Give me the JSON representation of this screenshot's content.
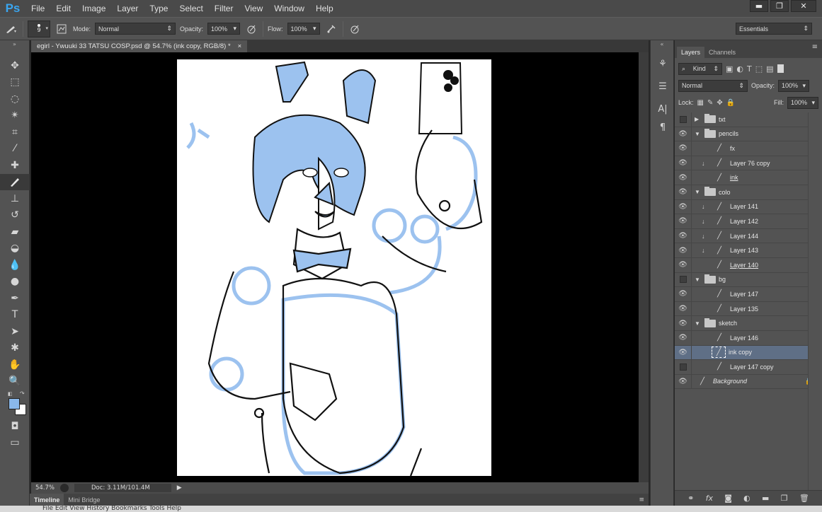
{
  "app": {
    "logo": "Ps"
  },
  "menu": [
    "File",
    "Edit",
    "Image",
    "Layer",
    "Type",
    "Select",
    "Filter",
    "View",
    "Window",
    "Help"
  ],
  "window_buttons": {
    "minimize": "▬",
    "restore": "❐",
    "close": "✕"
  },
  "options": {
    "brush_size": "9",
    "mode_label": "Mode:",
    "mode_value": "Normal",
    "opacity_label": "Opacity:",
    "opacity_value": "100%",
    "flow_label": "Flow:",
    "flow_value": "100%",
    "workspace": "Essentials"
  },
  "document": {
    "tab_title": "egirl - Ywuuki 33 TATSU COSP.psd @ 54.7% (ink copy, RGB/8) *",
    "tab_close": "×",
    "zoom": "54.7%",
    "doc_size": "Doc: 3.11M/101.4M"
  },
  "bottom_tabs": [
    "Timeline",
    "Mini Bridge"
  ],
  "taskbar_menu": "File   Edit   View   History   Bookmarks   Tools   Help",
  "layers_panel": {
    "tabs": [
      "Layers",
      "Channels"
    ],
    "filter_kind": "Kind",
    "blend_mode": "Normal",
    "opacity_label": "Opacity:",
    "opacity_value": "100%",
    "lock_label": "Lock:",
    "fill_label": "Fill:",
    "fill_value": "100%",
    "layers": [
      {
        "name": "txt",
        "type": "group",
        "visible": false,
        "expanded": false,
        "indent": 0
      },
      {
        "name": "pencils",
        "type": "group",
        "visible": true,
        "expanded": true,
        "indent": 0
      },
      {
        "name": "fx",
        "type": "layer",
        "visible": true,
        "indent": 1,
        "clip": false
      },
      {
        "name": "Layer 76 copy",
        "type": "layer",
        "visible": true,
        "indent": 1,
        "clip": true
      },
      {
        "name": "ink",
        "type": "layer",
        "visible": true,
        "indent": 1,
        "clip": false,
        "underline": true
      },
      {
        "name": "colo",
        "type": "group",
        "visible": true,
        "expanded": true,
        "indent": 0
      },
      {
        "name": "Layer 141",
        "type": "layer",
        "visible": true,
        "indent": 1,
        "clip": true
      },
      {
        "name": "Layer 142",
        "type": "layer",
        "visible": true,
        "indent": 1,
        "clip": true
      },
      {
        "name": "Layer 144",
        "type": "layer",
        "visible": true,
        "indent": 1,
        "clip": true
      },
      {
        "name": "Layer 143",
        "type": "layer",
        "visible": true,
        "indent": 1,
        "clip": true
      },
      {
        "name": "Layer 140",
        "type": "layer",
        "visible": true,
        "indent": 1,
        "clip": false,
        "underline": true
      },
      {
        "name": "bg",
        "type": "group",
        "visible": false,
        "expanded": true,
        "indent": 0
      },
      {
        "name": "Layer 147",
        "type": "layer",
        "visible": true,
        "indent": 1,
        "clip": false
      },
      {
        "name": "Layer 135",
        "type": "layer",
        "visible": true,
        "indent": 1,
        "clip": false
      },
      {
        "name": "sketch",
        "type": "group",
        "visible": true,
        "expanded": true,
        "indent": 0
      },
      {
        "name": "Layer 146",
        "type": "layer",
        "visible": true,
        "indent": 1,
        "clip": false
      },
      {
        "name": "ink copy",
        "type": "layer",
        "visible": true,
        "indent": 1,
        "clip": false,
        "selected": true
      },
      {
        "name": "Layer 147 copy",
        "type": "layer",
        "visible": false,
        "indent": 1,
        "clip": false
      },
      {
        "name": "Background",
        "type": "background",
        "visible": true,
        "indent": 0,
        "italic": true,
        "locked": true
      }
    ]
  },
  "colors": {
    "foreground": "#8ab8ea",
    "background": "#ffffff",
    "sketch_blue": "#9cc2ef",
    "ps_blue": "#3aa6f0"
  }
}
